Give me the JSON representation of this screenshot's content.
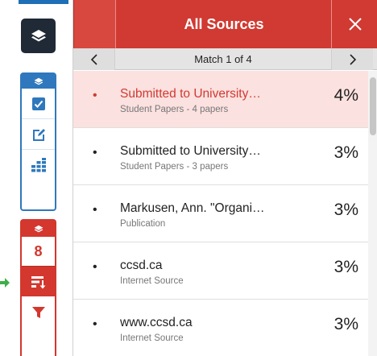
{
  "panel": {
    "title": "All Sources",
    "match_label": "Match 1 of 4"
  },
  "rail": {
    "red_count": "8"
  },
  "sources": [
    {
      "title": "Submitted to University…",
      "subtitle": "Student Papers - 4 papers",
      "percent": "4%",
      "active": true
    },
    {
      "title": "Submitted to University…",
      "subtitle": "Student Papers - 3 papers",
      "percent": "3%",
      "active": false
    },
    {
      "title": "Markusen, Ann. \"Organi…",
      "subtitle": "Publication",
      "percent": "3%",
      "active": false
    },
    {
      "title": "ccsd.ca",
      "subtitle": "Internet Source",
      "percent": "3%",
      "active": false
    },
    {
      "title": "www.ccsd.ca",
      "subtitle": "Internet Source",
      "percent": "3%",
      "active": false
    }
  ],
  "colors": {
    "header_red": "#d03a32",
    "rail_blue": "#2f78bd",
    "active_row_bg": "#fbe1df"
  }
}
